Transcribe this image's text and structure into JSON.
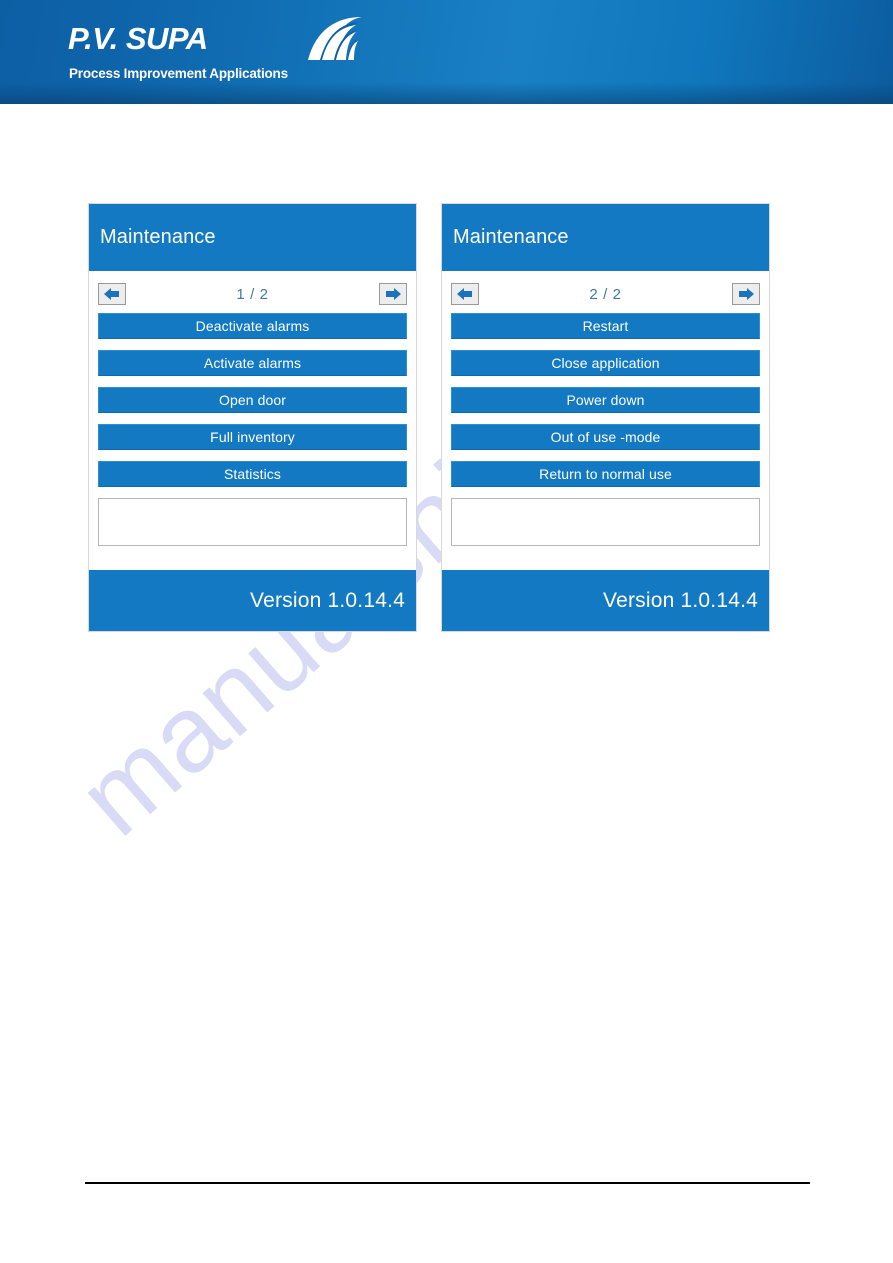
{
  "brand": {
    "wordmark": "P.V. SUPA",
    "tagline": "Process Improvement Applications",
    "swoosh_icon": "signal-waves-icon",
    "band_color": "#1077bd"
  },
  "watermark": {
    "text": "manualshive.com",
    "color": "#b9bdf0"
  },
  "theme": {
    "accent": "#1279c2",
    "button_border": "#2f8fd0",
    "pager_text": "#3f7ba6",
    "panel_border": "#d8d8d8"
  },
  "panels": [
    {
      "title": "Maintenance",
      "pager": {
        "prev_icon": "arrow-left-icon",
        "next_icon": "arrow-right-icon",
        "label": "1 / 2",
        "current_page": 1,
        "total_pages": 2
      },
      "buttons": [
        {
          "label": "Deactivate alarms"
        },
        {
          "label": "Activate alarms"
        },
        {
          "label": "Open door"
        },
        {
          "label": "Full inventory"
        },
        {
          "label": "Statistics"
        }
      ],
      "output": {
        "value": "",
        "placeholder": ""
      },
      "footer": {
        "version_label": "Version 1.0.14.4"
      }
    },
    {
      "title": "Maintenance",
      "pager": {
        "prev_icon": "arrow-left-icon",
        "next_icon": "arrow-right-icon",
        "label": "2 / 2",
        "current_page": 2,
        "total_pages": 2
      },
      "buttons": [
        {
          "label": "Restart"
        },
        {
          "label": "Close application"
        },
        {
          "label": "Power down"
        },
        {
          "label": "Out of use -mode"
        },
        {
          "label": "Return to normal use"
        }
      ],
      "output": {
        "value": "",
        "placeholder": ""
      },
      "footer": {
        "version_label": "Version 1.0.14.4"
      }
    }
  ]
}
